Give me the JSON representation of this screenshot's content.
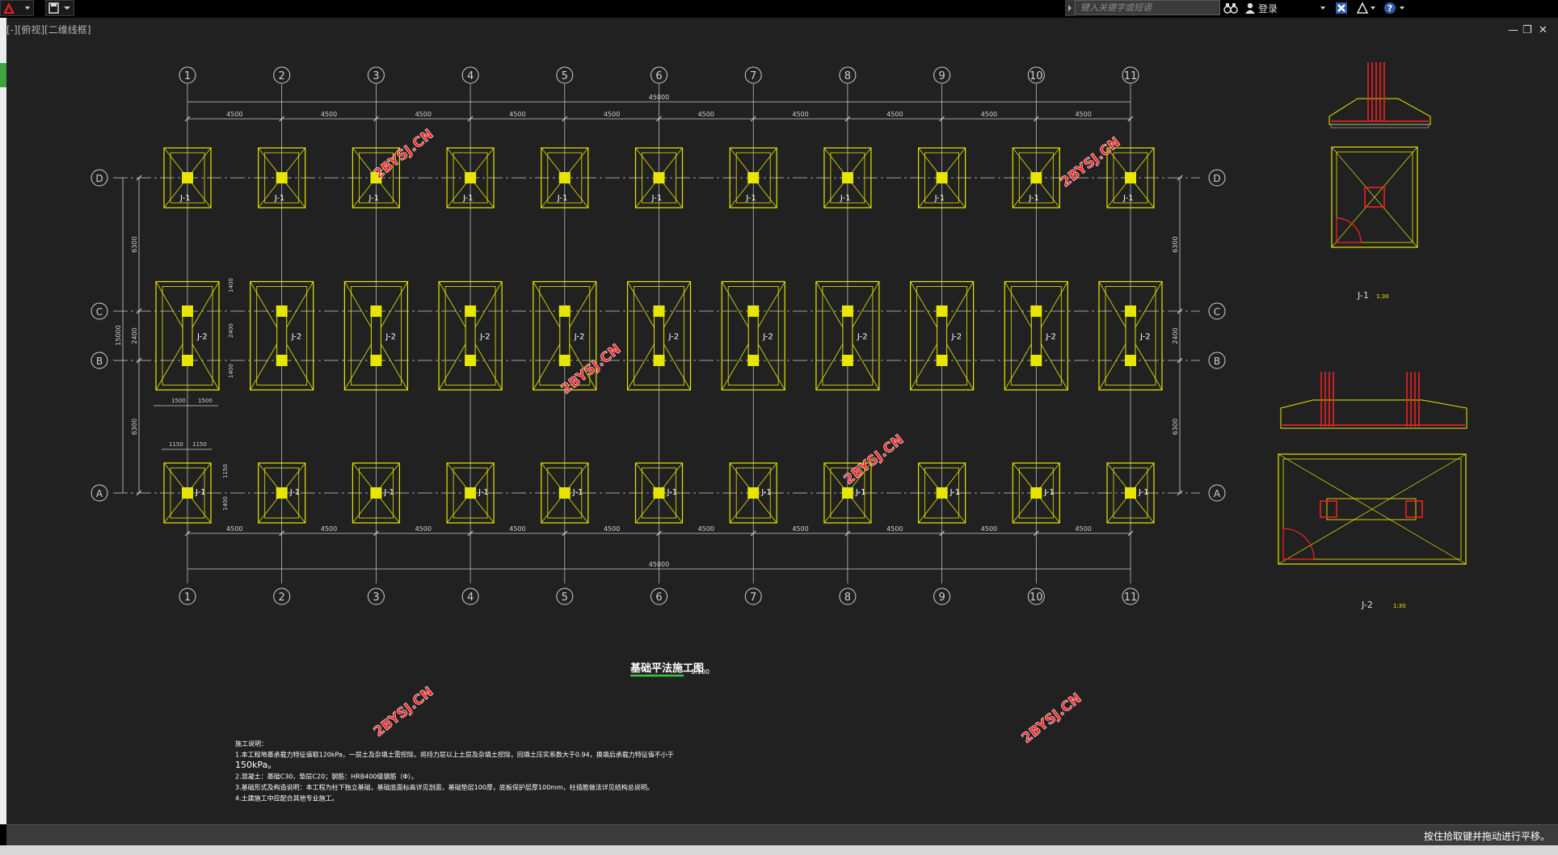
{
  "app": {
    "search_placeholder": "键入关键字或短语",
    "login_label": "登录",
    "viewport_label": "[-][俯视][二维线框]",
    "status_text": "按住拾取键并拖动进行平移。",
    "window_controls": [
      "minimize-icon",
      "restore-icon",
      "close-icon"
    ],
    "colors": {
      "background": "#212121",
      "yellow": "#e6e600",
      "axis": "#d0d0d0",
      "red": "#ff2020",
      "watermark": "#ff2222"
    }
  },
  "drawing": {
    "title": "基础平法施工图",
    "scale": "1:100",
    "column_axes": [
      "1",
      "2",
      "3",
      "4",
      "5",
      "6",
      "7",
      "8",
      "9",
      "10",
      "11"
    ],
    "row_axes": [
      "D",
      "C",
      "B",
      "A"
    ],
    "bay_dim": "4500",
    "total_dim": "45000",
    "row_dim_outer": "6300",
    "row_dim_middle": "2400",
    "total_row_dim": "15000",
    "footing_dims_j2": [
      "1500",
      "1500"
    ],
    "footing_dims_j1": [
      "1150",
      "1150"
    ],
    "j2_side_dims": [
      "1400",
      "2400",
      "1400"
    ],
    "j1_side_dims": [
      "1150",
      "1400"
    ],
    "footing_labels": {
      "j1": "J-1",
      "j2": "J-2"
    },
    "detail_j1": {
      "title": "J-1",
      "scale": "1:30"
    },
    "detail_j2": {
      "title": "J-2",
      "scale": "1:30"
    },
    "watermark": "2BYSJ.CN",
    "notes": [
      "施工说明：",
      "1.本工程地基承载力特征值取120kPa，一层土及杂填土需挖除，将持力层以上土层及杂填土挖除，回填土压实系数大于0.94，换填后承载力特征值不小于",
      "150kPa。",
      "2.混凝土：基础C30，垫层C20；钢筋：HRB400级钢筋（Φ）。",
      "3.基础形式及构造说明：本工程为柱下独立基础，基础底面标高详见剖面，基础垫层100厚，底板保护层厚100mm，柱插筋做法详见结构总说明。",
      "4.土建施工中应配合其他专业施工。"
    ]
  }
}
